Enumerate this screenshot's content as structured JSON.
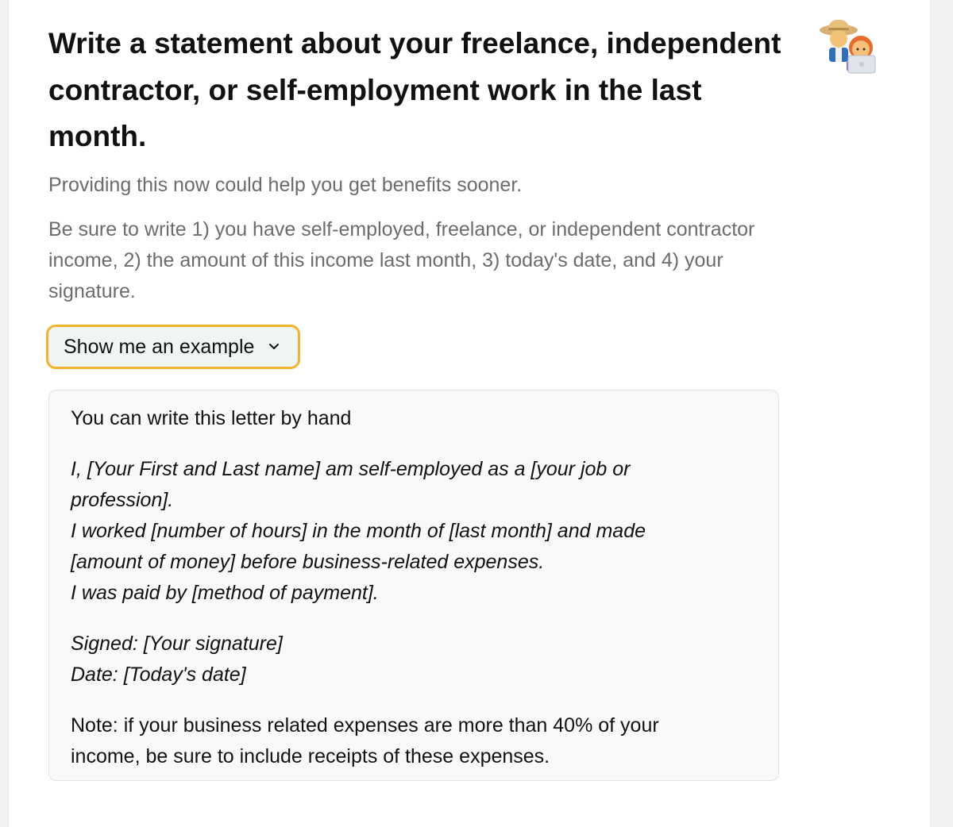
{
  "heading": "Write a statement about your freelance, independent contractor, or self-employment work in the last month.",
  "subtext": "Providing this now could help you get benefits sooner.",
  "instructions": "Be sure to write 1) you have self-employed, freelance, or independent contractor income, 2) the amount of this income last month, 3) today's date, and 4) your signature.",
  "example_toggle": {
    "label": "Show me an example",
    "icon": "chevron-down-icon",
    "focus_color": "#f5b22c"
  },
  "example": {
    "intro": "You can write this letter by hand",
    "letter_lines": [
      "I, [Your First and Last name] am self-employed as a [your job or profession].",
      "I worked [number of hours] in the month of [last month] and made [amount of money] before business-related expenses.",
      "I was paid by [method of payment]."
    ],
    "signed": "Signed: [Your signature]",
    "date": "Date: [Today's date]",
    "note": "Note: if your business related expenses are more than 40% of your income, be sure to include receipts of these expenses."
  },
  "illustration": {
    "icon": "freelancers-illustration-icon"
  }
}
